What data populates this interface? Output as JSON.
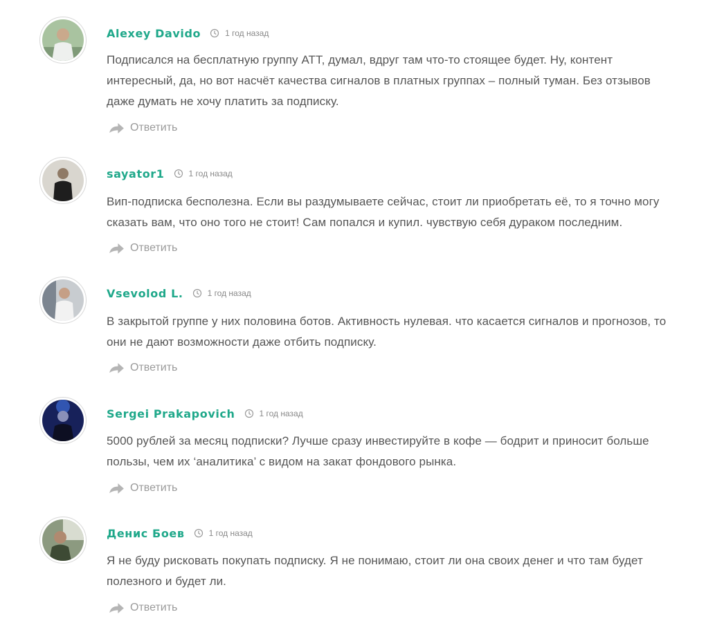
{
  "comments": [
    {
      "author": "Alexey Davido",
      "time": "1 год назад",
      "text": "Подписался на бесплатную группу АТТ, думал, вдруг там что-то стоящее будет. Ну, контент интересный, да, но вот насчёт качества сигналов в платных группах – полный туман. Без отзывов даже думать не хочу платить за подписку.",
      "reply": "Ответить",
      "avatar_color": "#8aa78c"
    },
    {
      "author": "sayator1",
      "time": "1 год назад",
      "text": "Вип-подписка бесполезна. Если вы раздумываете сейчас, стоит ли приобретать её, то я точно могу сказать вам, что оно того не стоит! Сам попался и купил. чувствую себя дураком последним.",
      "reply": "Ответить",
      "avatar_color": "#5c5a55"
    },
    {
      "author": "Vsevolod L.",
      "time": "1 год назад",
      "text": "В закрытой группе у них половина ботов. Активность нулевая. что касается сигналов и прогнозов, то они не дают возможности даже отбить подписку.",
      "reply": "Ответить",
      "avatar_color": "#9aa0a6"
    },
    {
      "author": "Sergei Prakapovich",
      "time": "1 год назад",
      "text": "5000 рублей за месяц подписки? Лучше сразу инвестируйте в кофе — бодрит и приносит больше пользы, чем их ‘аналитика’ с видом на закат фондового рынка.",
      "reply": "Ответить",
      "avatar_color": "#23306a"
    },
    {
      "author": "Денис Боев",
      "time": "1 год назад",
      "text": "Я не буду рисковать покупать подписку. Я не понимаю, стоит ли она своих денег и что там будет полезного и будет ли.",
      "reply": "Ответить",
      "avatar_color": "#6d7a5e"
    }
  ],
  "colors": {
    "author": "#1fa88a",
    "text": "#555555",
    "muted": "#9a9a9a"
  }
}
